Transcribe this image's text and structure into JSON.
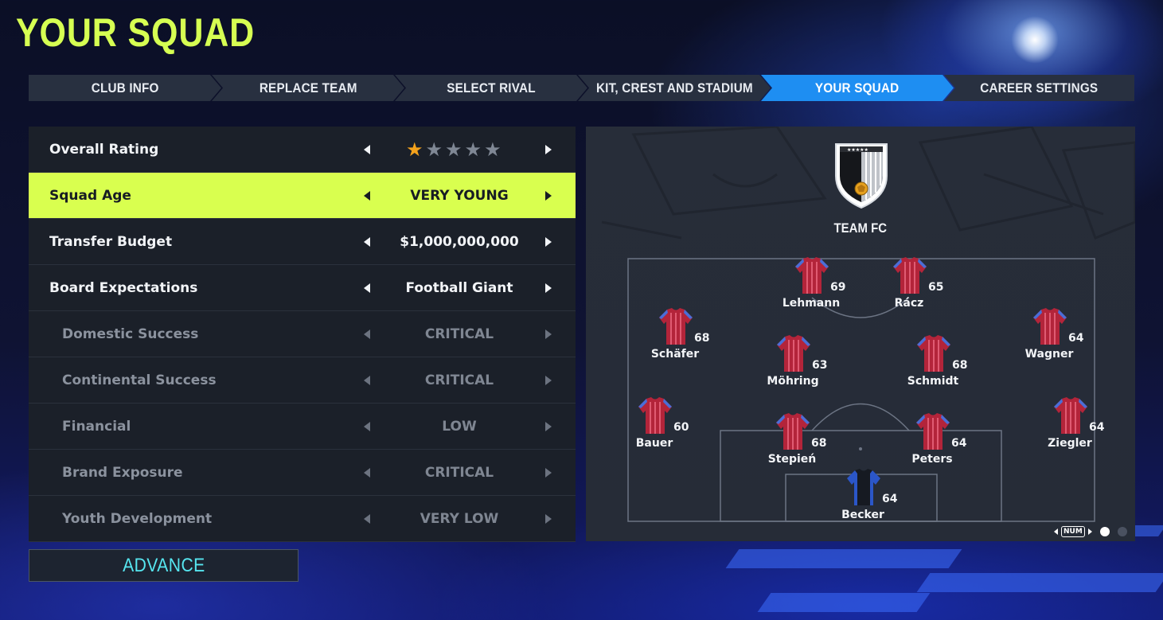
{
  "page": {
    "title": "YOUR SQUAD"
  },
  "steps": [
    {
      "label": "CLUB INFO",
      "active": false
    },
    {
      "label": "REPLACE TEAM",
      "active": false
    },
    {
      "label": "SELECT RIVAL",
      "active": false
    },
    {
      "label": "KIT, CREST AND STADIUM",
      "active": false
    },
    {
      "label": "YOUR SQUAD",
      "active": true
    },
    {
      "label": "CAREER SETTINGS",
      "active": false
    }
  ],
  "settings": {
    "overall_rating": {
      "label": "Overall Rating",
      "stars_filled": 1,
      "stars_total": 5
    },
    "squad_age": {
      "label": "Squad Age",
      "value": "VERY YOUNG"
    },
    "transfer_budget": {
      "label": "Transfer Budget",
      "value": "$1,000,000,000"
    },
    "board_expectations": {
      "label": "Board Expectations",
      "value": "Football Giant"
    },
    "domestic_success": {
      "label": "Domestic Success",
      "value": "CRITICAL"
    },
    "continental_success": {
      "label": "Continental Success",
      "value": "CRITICAL"
    },
    "financial": {
      "label": "Financial",
      "value": "LOW"
    },
    "brand_exposure": {
      "label": "Brand Exposure",
      "value": "CRITICAL"
    },
    "youth_development": {
      "label": "Youth Development",
      "value": "VERY LOW"
    }
  },
  "advance": {
    "label": "ADVANCE"
  },
  "team": {
    "name": "TEAM FC"
  },
  "players": {
    "lehmann": {
      "name": "Lehmann",
      "rating": "69"
    },
    "racz": {
      "name": "Rácz",
      "rating": "65"
    },
    "schafer": {
      "name": "Schäfer",
      "rating": "68"
    },
    "mohring": {
      "name": "Möhring",
      "rating": "63"
    },
    "schmidt": {
      "name": "Schmidt",
      "rating": "68"
    },
    "wagner": {
      "name": "Wagner",
      "rating": "64"
    },
    "bauer": {
      "name": "Bauer",
      "rating": "60"
    },
    "stepien": {
      "name": "Stepień",
      "rating": "68"
    },
    "peters": {
      "name": "Peters",
      "rating": "64"
    },
    "ziegler": {
      "name": "Ziegler",
      "rating": "64"
    },
    "becker": {
      "name": "Becker",
      "rating": "64"
    }
  },
  "pager": {
    "badge": "NUM",
    "pages": 2,
    "current": 1
  },
  "colors": {
    "accent_lime": "#d9ff4f",
    "title_lime": "#d6ff52",
    "active_step": "#1e8ef2",
    "advance_text": "#56e6f0",
    "star_on": "#f4a21c",
    "jersey_red": "#b3243a",
    "keeper_blue": "#2b56c8"
  }
}
